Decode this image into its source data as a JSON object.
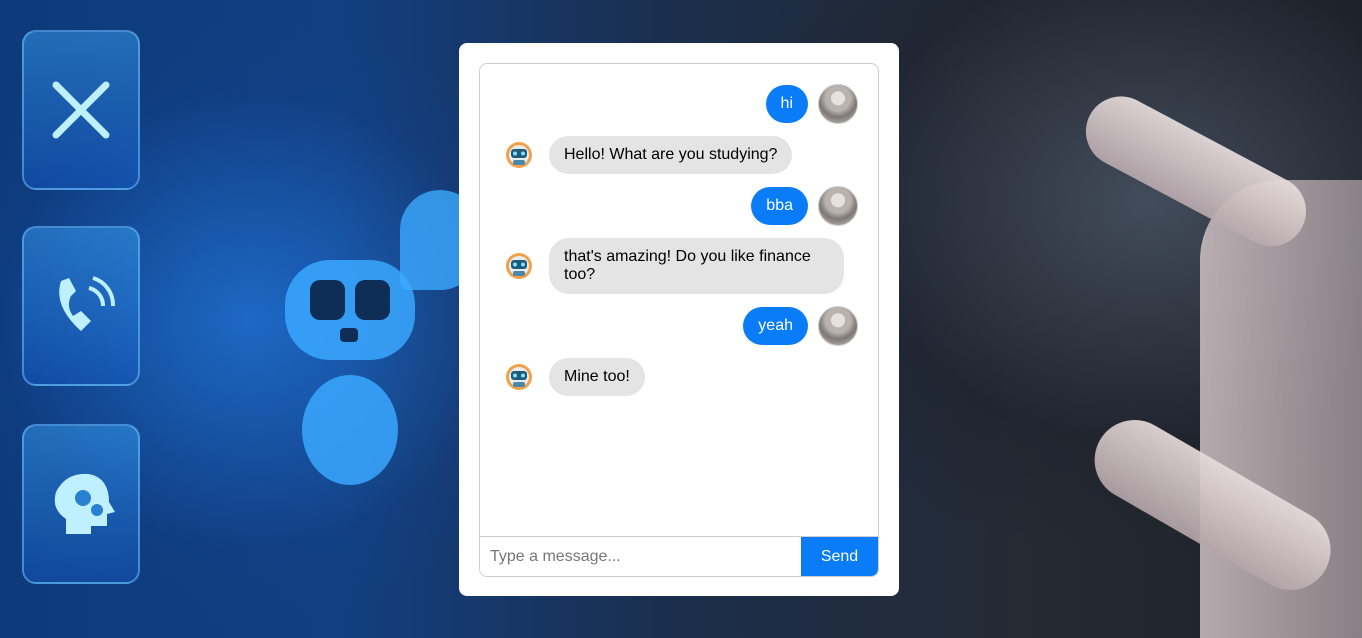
{
  "colors": {
    "accent": "#0a7cf8",
    "bot_bubble": "#e4e4e4",
    "card": "#ffffff"
  },
  "messages": [
    {
      "sender": "user",
      "text": "hi"
    },
    {
      "sender": "bot",
      "text": "Hello! What are you studying?"
    },
    {
      "sender": "user",
      "text": "bba"
    },
    {
      "sender": "bot",
      "text": "that's amazing! Do you like finance too?"
    },
    {
      "sender": "user",
      "text": "yeah"
    },
    {
      "sender": "bot",
      "text": "Mine too!"
    }
  ],
  "composer": {
    "placeholder": "Type a message...",
    "send_label": "Send"
  },
  "icons": {
    "user_avatar": "user-avatar-icon",
    "bot_avatar": "robot-avatar-icon"
  }
}
